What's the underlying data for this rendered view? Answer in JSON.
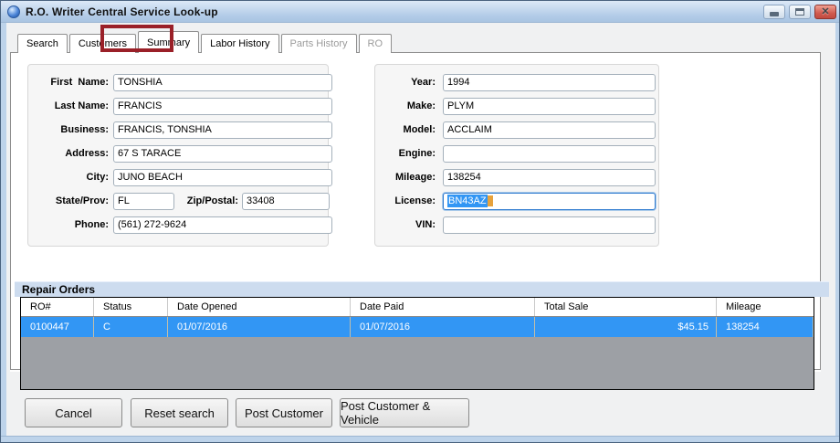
{
  "window": {
    "title": "R.O. Writer Central Service Look-up"
  },
  "tabs": [
    {
      "label": "Search",
      "state": "enabled"
    },
    {
      "label": "Customers",
      "state": "enabled"
    },
    {
      "label": "Summary",
      "state": "active",
      "annotated": true
    },
    {
      "label": "Labor History",
      "state": "enabled"
    },
    {
      "label": "Parts History",
      "state": "disabled"
    },
    {
      "label": "RO",
      "state": "disabled"
    }
  ],
  "customer": {
    "fields": [
      {
        "label": "First  Name:",
        "value": "TONSHIA"
      },
      {
        "label": "Last Name:",
        "value": "FRANCIS"
      },
      {
        "label": "Business:",
        "value": "FRANCIS, TONSHIA"
      },
      {
        "label": "Address:",
        "value": "67 S TARACE"
      },
      {
        "label": "City:",
        "value": "JUNO BEACH"
      },
      {
        "label": "State/Prov:",
        "value": "FL"
      },
      {
        "label": "Zip/Postal:",
        "value": "33408"
      },
      {
        "label": "Phone:",
        "value": "(561) 272-9624"
      }
    ]
  },
  "vehicle": {
    "fields": [
      {
        "label": "Year:",
        "value": "1994"
      },
      {
        "label": "Make:",
        "value": "PLYM"
      },
      {
        "label": "Model:",
        "value": "ACCLAIM"
      },
      {
        "label": "Engine:",
        "value": ""
      },
      {
        "label": "Mileage:",
        "value": "138254"
      },
      {
        "label": "License:",
        "value": "BN43AZ",
        "selected": true
      },
      {
        "label": "VIN:",
        "value": ""
      }
    ]
  },
  "repair_orders": {
    "section_title": "Repair Orders",
    "columns": [
      "RO#",
      "Status",
      "Date Opened",
      "Date Paid",
      "Total Sale",
      "Mileage"
    ],
    "rows": [
      {
        "ro": "0100447",
        "status": "C",
        "date_opened": "01/07/2016",
        "date_paid": "01/07/2016",
        "total_sale": "$45.15",
        "mileage": "138254",
        "selected": true
      }
    ]
  },
  "buttons": [
    {
      "label": "Cancel"
    },
    {
      "label": "Reset search"
    },
    {
      "label": "Post Customer"
    },
    {
      "label": "Post Customer & Vehicle"
    }
  ],
  "colors": {
    "selection_blue": "#3296f4",
    "annotation_red": "#9a2028",
    "titlebar_blue": "#b9d0e8",
    "close_button_red": "#d05a4e",
    "section_strip_blue": "#cddcef",
    "table_empty_gray": "#9da0a5",
    "selection_caret_orange": "#e7a23c"
  }
}
